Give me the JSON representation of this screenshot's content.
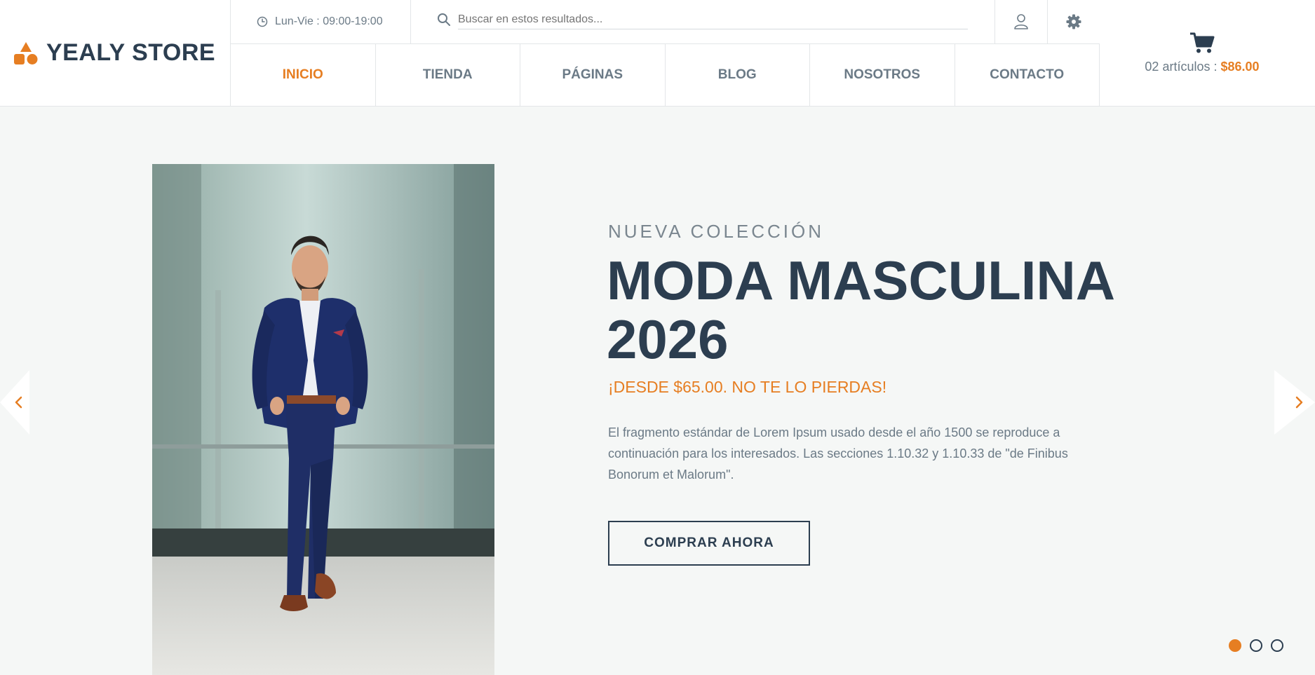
{
  "brand": {
    "name": "YEALY STORE",
    "accent": "#e67e22",
    "dark": "#2c3e50"
  },
  "topbar": {
    "hours": "Lun-Vie : 09:00-19:00",
    "search_placeholder": "Buscar en estos resultados...",
    "icons": [
      "clock-icon",
      "search-icon",
      "user-icon",
      "gear-icon"
    ]
  },
  "nav": {
    "items": [
      {
        "label": "INICIO",
        "active": true
      },
      {
        "label": "TIENDA",
        "active": false
      },
      {
        "label": "PÁGINAS",
        "active": false
      },
      {
        "label": "BLOG",
        "active": false
      },
      {
        "label": "NOSOTROS",
        "active": false
      },
      {
        "label": "CONTACTO",
        "active": false
      }
    ]
  },
  "cart": {
    "items_label": "02 artículos :",
    "total": "$86.00"
  },
  "hero": {
    "eyebrow": "NUEVA COLECCIÓN",
    "headline_line1": "MODA MASCULINA",
    "headline_line2": "2026",
    "promo": "¡DESDE $65.00. NO TE LO PIERDAS!",
    "description": "El fragmento estándar de Lorem Ipsum usado desde el año 1500 se reproduce a continuación para los interesados. Las secciones 1.10.32 y 1.10.33 de \"de Finibus Bonorum et Malorum\".",
    "cta": "COMPRAR AHORA",
    "slides_total": 3,
    "slide_active": 1
  }
}
